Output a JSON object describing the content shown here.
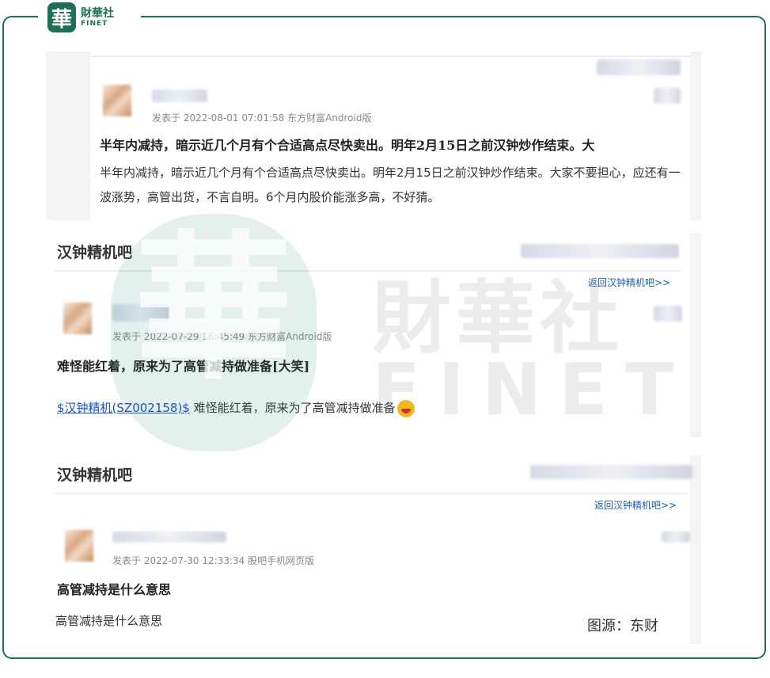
{
  "brand": {
    "mark": "華",
    "name_cn": "財華社",
    "name_en": "FINET"
  },
  "watermark": {
    "mark": "華",
    "name_cn": "財華社",
    "name_en": "FINET"
  },
  "post1": {
    "meta": "发表于 2022-08-01 07:01:58 东方财富Android版",
    "title": "半年内减持，暗示近几个月有个合适高点尽快卖出。明年2月15日之前汉钟炒作结束。大",
    "body": "半年内减持，暗示近几个月有个合适高点尽快卖出。明年2月15日之前汉钟炒作结束。大家不要担心，应还有一波涨势，高管出货，不言自明。6个月内股价能涨多高，不好猜。"
  },
  "post2": {
    "section": "汉钟精机吧",
    "back_link": "返回汉钟精机吧>>",
    "meta": "发表于 2022-07-29 16:45:49 东方财富Android版",
    "title": "难怪能红着，原来为了高管减持做准备[大笑]",
    "stock_link": "$汉钟精机(SZ002158)$",
    "body": " 难怪能红着，原来为了高管减持做准备",
    "emoji": "laugh-emoji"
  },
  "post3": {
    "section": "汉钟精机吧",
    "back_link": "返回汉钟精机吧>>",
    "meta": "发表于 2022-07-30 12:33:34 股吧手机网页版",
    "title": "高管减持是什么意思",
    "body": "高管减持是什么意思"
  },
  "caption": "图源：东财",
  "colors": {
    "accent": "#1e6e58",
    "link": "#1a5fb4"
  }
}
